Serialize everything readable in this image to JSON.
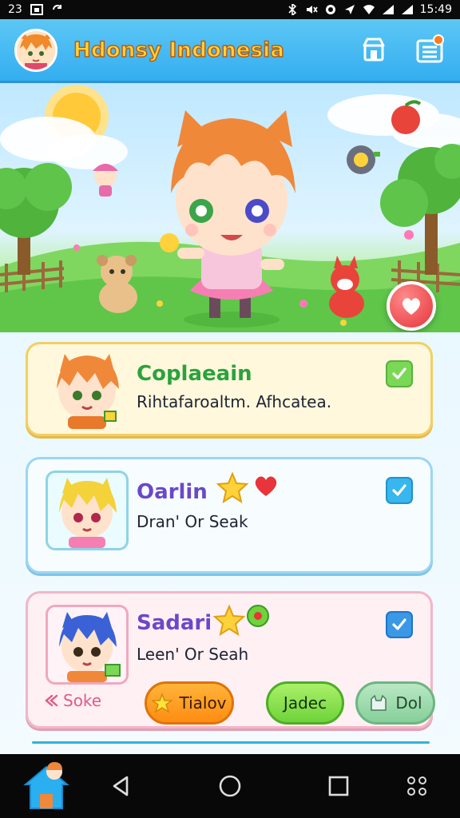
{
  "status_bar": {
    "left_text": "23",
    "time": "15:49"
  },
  "app_bar": {
    "title": "Hdonsy Indonesia",
    "icons": [
      "avatar-icon",
      "shop-icon",
      "menu-list-icon"
    ]
  },
  "cards": [
    {
      "title": "Coplaeain",
      "subtitle": "Rihtafaroaltm. Afhcatea.",
      "checked": true,
      "check_color": "#7bd857"
    },
    {
      "title": "Oarlin",
      "subtitle": "Dran' Or Seak",
      "checked": true,
      "check_color": "#38b6ee"
    },
    {
      "title": "Sadari",
      "subtitle": "Leen' Or Seah",
      "checked": true,
      "check_color": "#3a98e6",
      "actions": {
        "share_label": "Soke",
        "primary_label": "Tialov",
        "secondary_label": "Jadec",
        "tertiary_label": "Dol"
      }
    }
  ],
  "colors": {
    "app_bar": "#34aef0",
    "title_fill": "#ffd23c",
    "fab": "#e5343a"
  }
}
